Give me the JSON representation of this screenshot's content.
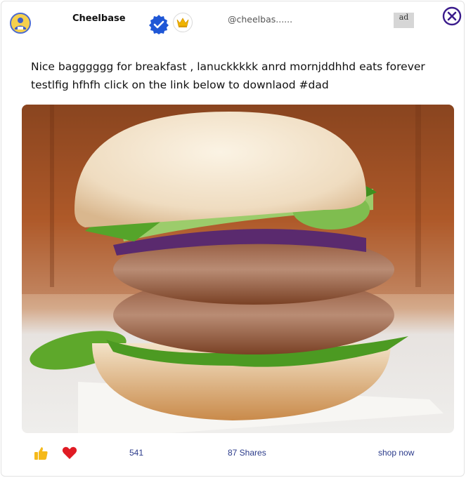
{
  "post": {
    "username": "Cheelbase",
    "handle": "@cheelbas......",
    "ad_label": "ad",
    "caption": "Nice bagggggg for breakfast , lanuckkkkk anrd mornjddhhd eats forever testlfig hfhfh click on the link below to downlaod #dad",
    "image_subject": "burger-with-spinach-cucumber-onion-and-patties"
  },
  "footer": {
    "likes_count": "541",
    "shares_label": "87 Shares",
    "shop_label": "shop now"
  },
  "icons": {
    "avatar": "avatar-icon",
    "verified": "verified-check-icon",
    "crown": "crown-icon",
    "close": "close-circle-icon",
    "like": "thumbs-up-icon",
    "heart": "heart-icon"
  },
  "colors": {
    "verified_blue": "#1f57d6",
    "crown_gold": "#f0b400",
    "close_purple": "#3b1c8c",
    "like_yellow": "#f5b91a",
    "heart_red": "#e01b24",
    "footer_text": "#2a3a8a"
  }
}
